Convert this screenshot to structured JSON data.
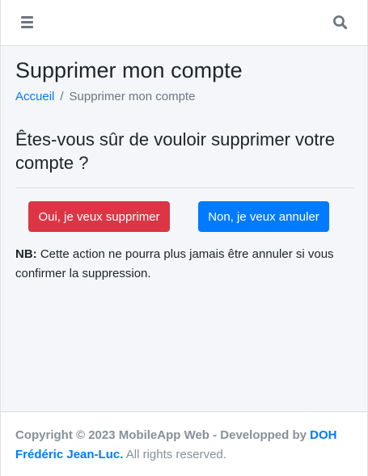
{
  "header": {
    "menu_icon": "hamburger-icon",
    "search_icon": "search-icon"
  },
  "page": {
    "title": "Supprimer mon compte",
    "breadcrumb": {
      "home": "Accueil",
      "separator": "/",
      "current": "Supprimer mon compte"
    },
    "question": "Êtes-vous sûr de vouloir supprimer votre compte ?",
    "buttons": {
      "confirm": "Oui, je veux supprimer",
      "cancel": "Non, je veux annuler"
    },
    "note": {
      "label": "NB:",
      "text": " Cette action ne pourra plus jamais être annuler si vous confirmer la suppression."
    }
  },
  "footer": {
    "copyright": "Copyright © 2023 MobileApp Web - Developped by ",
    "author": "DOH Frédéric Jean-Luc.",
    "rights": " All rights reserved."
  },
  "colors": {
    "danger": "#dc3545",
    "primary": "#007bff",
    "background": "#f4f6f9"
  }
}
